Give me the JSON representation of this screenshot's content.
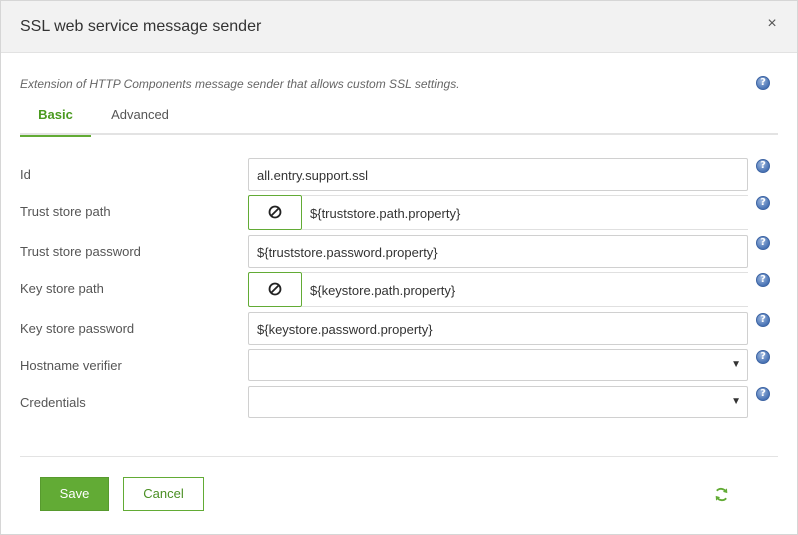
{
  "dialog": {
    "title": "SSL web service message sender",
    "close_glyph": "×",
    "description": "Extension of HTTP Components message sender that allows custom SSL settings."
  },
  "tabs": [
    {
      "label": "Basic",
      "active": true
    },
    {
      "label": "Advanced",
      "active": false
    }
  ],
  "fields": {
    "id": {
      "label": "Id",
      "value": "all.entry.support.ssl"
    },
    "trust_store_path": {
      "label": "Trust store path",
      "value": "${truststore.path.property}",
      "toggle_icon": "no-entry-icon"
    },
    "trust_store_password": {
      "label": "Trust store password",
      "value": "${truststore.password.property}"
    },
    "key_store_path": {
      "label": "Key store path",
      "value": "${keystore.path.property}",
      "toggle_icon": "no-entry-icon"
    },
    "key_store_password": {
      "label": "Key store password",
      "value": "${keystore.password.property}"
    },
    "hostname_verifier": {
      "label": "Hostname verifier",
      "value": ""
    },
    "credentials": {
      "label": "Credentials",
      "value": ""
    }
  },
  "help_glyph": "?",
  "caret_glyph": "▼",
  "footer": {
    "save_label": "Save",
    "cancel_label": "Cancel"
  },
  "colors": {
    "accent": "#62ab35",
    "help": "#4a74b5",
    "header_bg": "#f2f2f2"
  }
}
